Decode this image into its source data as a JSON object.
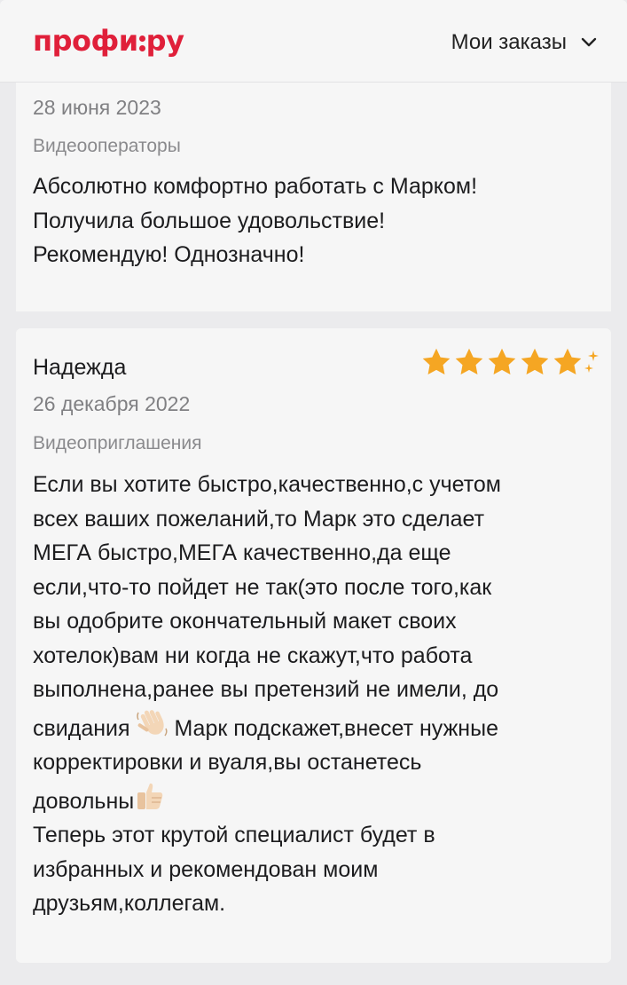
{
  "header": {
    "logo_left": "профи",
    "logo_right": "ру",
    "orders_label": "Мои заказы"
  },
  "reviews": [
    {
      "date": "28 июня 2023",
      "category": "Видеооператоры",
      "text": "Абсолютно комфортно работать с Марком!\nПолучила большое удовольствие!\nРекомендую! Однозначно!"
    },
    {
      "author": "Надежда",
      "rating": 5,
      "date": "26 декабря 2022",
      "category": "Видеоприглашения",
      "text_part1": "Если вы хотите быстро,качественно,с учетом\nвсех ваших пожеланий,то Марк это сделает\nМЕГА быстро,МЕГА качественно,да еще\nесли,что-то пойдет не так(это после того,как\nвы одобрите окончательный макет своих\nхотелок)вам ни когда не скажут,что работа\nвыполнена,ранее вы претензий не имели, до\nсвидания ",
      "text_part2": " Марк подскажет,внесет нужные\nкорректировки и вуаля,вы останетесь\nдовольны",
      "text_part3": "\nТеперь этот крутой специалист будет в\nизбранных и рекомендован моим\nдрузьям,коллегам."
    }
  ],
  "colors": {
    "brand": "#e0203a",
    "star": "#f5a623",
    "background": "#ebebed",
    "card": "#f6f6f6"
  },
  "icons": [
    "chevron-down-icon",
    "star-icon",
    "sparkle-icon",
    "waving-hand-icon",
    "thumbs-up-icon"
  ]
}
